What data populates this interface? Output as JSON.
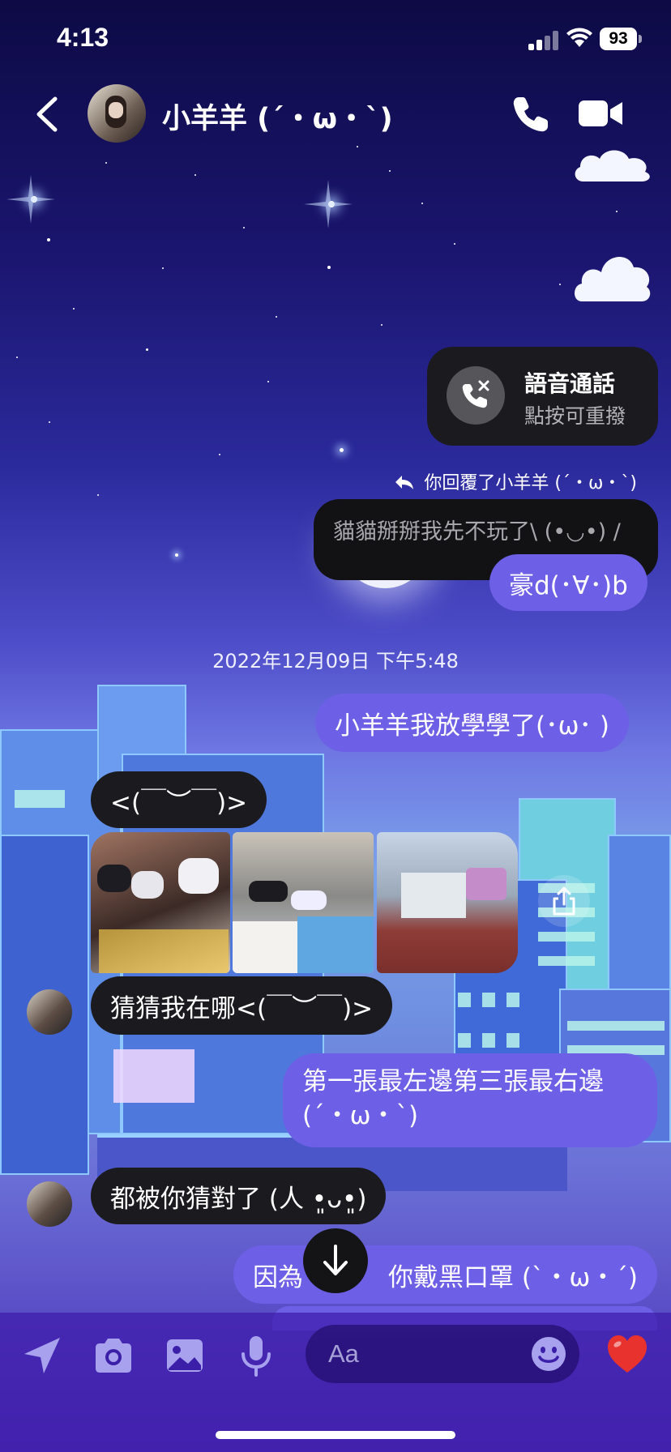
{
  "status_bar": {
    "time": "4:13",
    "battery": "93"
  },
  "header": {
    "contact_name": "小羊羊 (´・ω・`)"
  },
  "call_card": {
    "title": "語音通話",
    "subtitle": "點按可重撥"
  },
  "reply": {
    "label": "你回覆了小羊羊 (´・ω・`)",
    "quoted_text": "貓貓掰掰我先不玩了\\ (•◡•) /",
    "text": "豪d(･∀･)b"
  },
  "timestamp": "2022年12月09日 下午5:48",
  "messages": [
    {
      "direction": "outgoing",
      "text": "小羊羊我放學學了(･ω･ )"
    },
    {
      "direction": "incoming",
      "text": "<(￣︶￣)>"
    },
    {
      "direction": "incoming",
      "type": "photos",
      "count": 3
    },
    {
      "direction": "incoming",
      "text": "猜猜我在哪<(￣︶￣)>"
    },
    {
      "direction": "outgoing",
      "text_line1": "第一張最左邊第三張最右邊",
      "text_line2": "(´・ω・`)"
    },
    {
      "direction": "incoming",
      "text": "都被你猜對了 (人 •͈ᴗ•͈)"
    },
    {
      "direction": "outgoing",
      "text_prefix": "因為",
      "text_suffix": "你戴黑口罩 (`・ω・´)"
    }
  ],
  "composer": {
    "placeholder": "Aa"
  },
  "icons": [
    "back-chevron-icon",
    "phone-icon",
    "video-camera-icon",
    "cloud-icon",
    "phone-missed-icon",
    "reply-arrow-icon",
    "share-icon",
    "arrow-down-icon",
    "send-location-icon",
    "camera-icon",
    "gallery-icon",
    "microphone-icon",
    "smiley-icon",
    "heart-icon"
  ],
  "colors": {
    "outgoing_bubble": "#6d5fe6",
    "incoming_bubble": "#1b1b1f",
    "heart": "#e8322e"
  }
}
